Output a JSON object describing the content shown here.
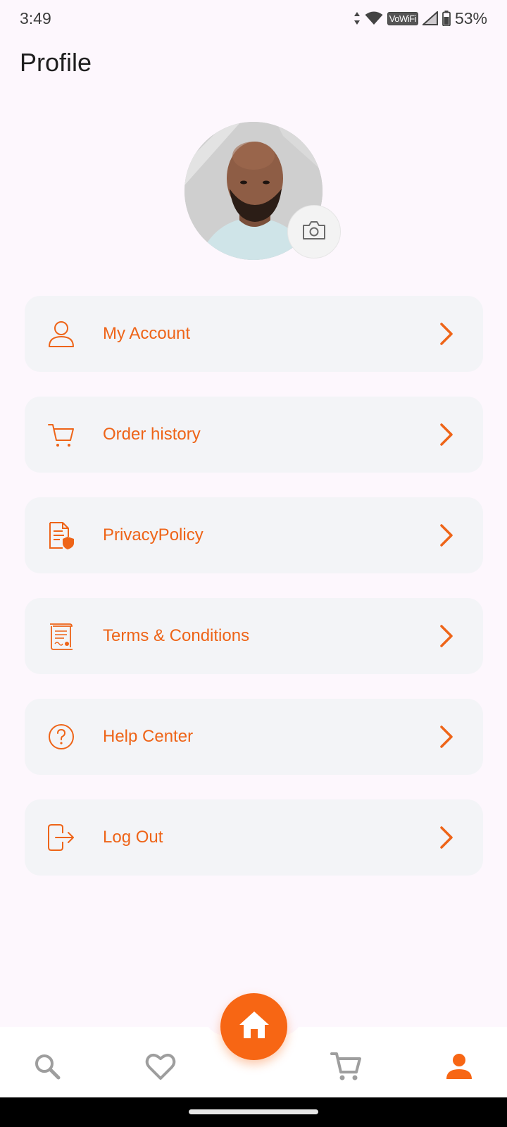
{
  "status_bar": {
    "time": "3:49",
    "vowifi": "VoWiFi",
    "battery": "53%"
  },
  "header": {
    "title": "Profile"
  },
  "menu": {
    "items": [
      {
        "label": "My Account",
        "icon": "user-icon"
      },
      {
        "label": "Order history",
        "icon": "cart-icon"
      },
      {
        "label": "PrivacyPolicy",
        "icon": "privacy-document-icon"
      },
      {
        "label": "Terms & Conditions",
        "icon": "terms-scroll-icon"
      },
      {
        "label": "Help Center",
        "icon": "help-circle-icon"
      },
      {
        "label": "Log Out",
        "icon": "logout-icon"
      }
    ]
  },
  "bottom_nav": {
    "items": [
      "search-icon",
      "heart-icon",
      "home-icon",
      "cart-icon",
      "profile-icon"
    ],
    "active": "profile-icon"
  },
  "colors": {
    "accent": "#f76614",
    "menu_text": "#ee6418",
    "menu_bg": "#f3f4f7",
    "page_bg": "#fdf7fd",
    "inactive_nav": "#9e9e9e"
  }
}
